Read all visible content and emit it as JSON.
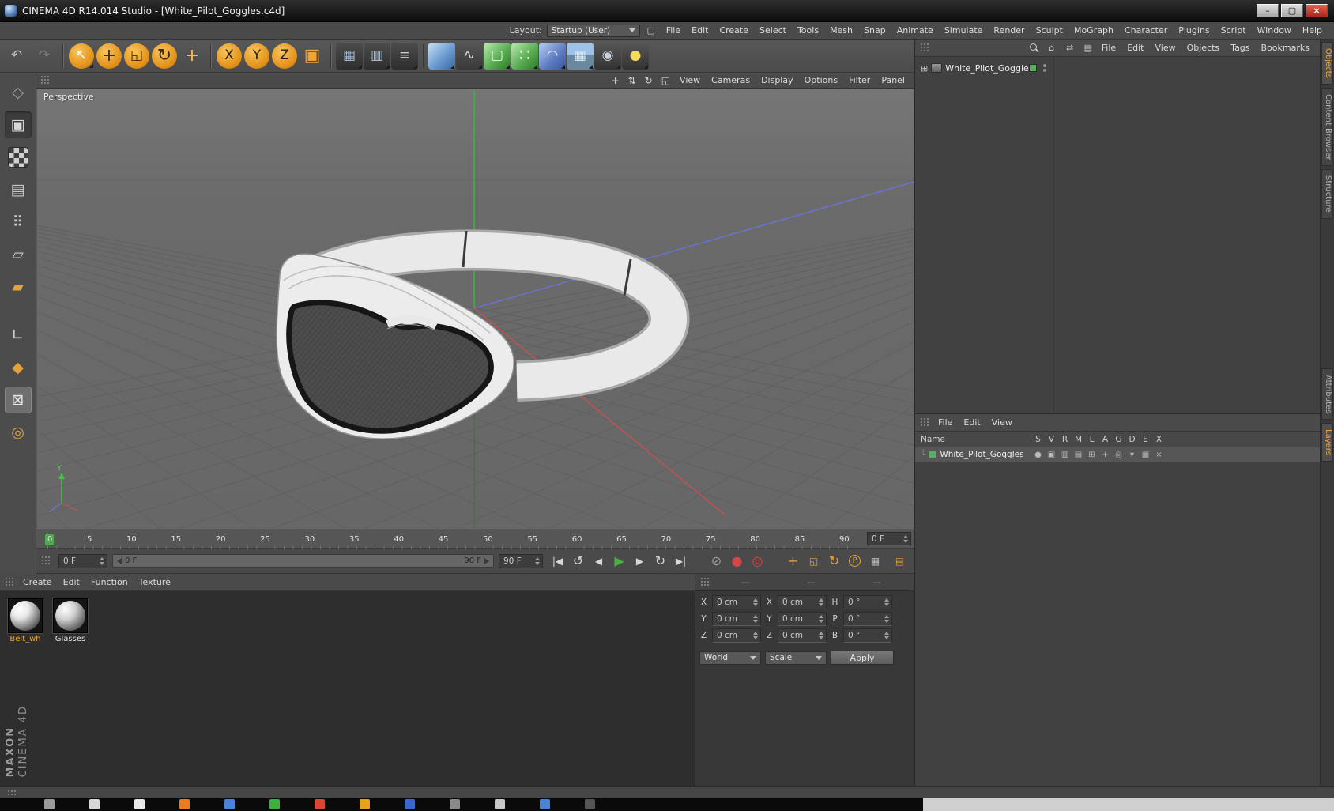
{
  "window": {
    "title": "CINEMA 4D R14.014 Studio - [White_Pilot_Goggles.c4d]",
    "minimize": "–",
    "maximize": "▢",
    "close": "×"
  },
  "menubar": {
    "items": [
      "File",
      "Edit",
      "Create",
      "Select",
      "Tools",
      "Mesh",
      "Snap",
      "Animate",
      "Simulate",
      "Render",
      "Sculpt",
      "MoGraph",
      "Character",
      "Plugins",
      "Script",
      "Window",
      "Help"
    ],
    "layout_label": "Layout:",
    "layout_value": "Startup (User)",
    "pin_glyph": "▢"
  },
  "toolbar": {
    "history": [
      {
        "name": "undo-icon",
        "glyph": "↶",
        "fg": "#c9c9c9"
      },
      {
        "name": "redo-icon",
        "glyph": "↷",
        "fg": "#828282"
      }
    ],
    "tools": [
      {
        "name": "live-selection-icon",
        "glyph": "↖",
        "fg": "#ffffff",
        "bg": "radial-gradient(circle at 38% 32%, #f8c55e, #e28f16 68%, #b06a08)",
        "cls": "round dd"
      },
      {
        "name": "move-tool-icon",
        "glyph": "+",
        "fg": "#3a2a08",
        "bg": "radial-gradient(circle at 38% 32%, #f8c55e, #e28f16 68%, #b06a08)",
        "cls": "round big"
      },
      {
        "name": "scale-tool-icon",
        "glyph": "◱",
        "fg": "#3a2a08",
        "bg": "radial-gradient(circle at 38% 32%, #f8c55e, #e28f16 68%, #b06a08)",
        "cls": "round"
      },
      {
        "name": "rotate-tool-icon",
        "glyph": "↻",
        "fg": "#3a2a08",
        "bg": "radial-gradient(circle at 38% 32%, #f8c55e, #e28f16 68%, #b06a08)",
        "cls": "round big"
      },
      {
        "name": "last-tool-icon",
        "glyph": "+",
        "fg": "#f6c244",
        "cls": "big"
      }
    ],
    "axis": [
      {
        "name": "lock-x-axis-icon",
        "glyph": "X",
        "fg": "#2b2108",
        "bg": "radial-gradient(circle at 38% 32%, #f8c55e, #e28f16 68%, #b06a08)",
        "cls": "round"
      },
      {
        "name": "lock-y-axis-icon",
        "glyph": "Y",
        "fg": "#2b2108",
        "bg": "radial-gradient(circle at 38% 32%, #f8c55e, #e28f16 68%, #b06a08)",
        "cls": "round"
      },
      {
        "name": "lock-z-axis-icon",
        "glyph": "Z",
        "fg": "#2b2108",
        "bg": "radial-gradient(circle at 38% 32%, #f8c55e, #e28f16 68%, #b06a08)",
        "cls": "round"
      },
      {
        "name": "coordinate-system-icon",
        "glyph": "▣",
        "fg": "#f0a43a",
        "cls": "big"
      }
    ],
    "render": [
      {
        "name": "render-view-icon",
        "glyph": "▦",
        "fg": "#a9c1d9",
        "bg": "linear-gradient(#4c4c4c,#2e2e2e)",
        "cls": "dd"
      },
      {
        "name": "render-picture-viewer-icon",
        "glyph": "▥",
        "fg": "#a9c1d9",
        "bg": "linear-gradient(#4c4c4c,#2e2e2e)",
        "cls": "dd"
      },
      {
        "name": "render-settings-icon",
        "glyph": "≡",
        "fg": "#c9c9c9",
        "bg": "linear-gradient(#4c4c4c,#2e2e2e)",
        "cls": "dd"
      }
    ],
    "objects": [
      {
        "name": "add-cube-icon",
        "glyph": "",
        "fg": "#ffffff",
        "bg": "linear-gradient(135deg,#b9d5f1 10%,#6a9ad0 55%,#38659f)",
        "cls": "dd"
      },
      {
        "name": "add-spline-icon",
        "glyph": "∿",
        "fg": "#e2e9f1",
        "bg": "linear-gradient(#565656,#393939)",
        "cls": "dd"
      },
      {
        "name": "add-generator-icon",
        "glyph": "▢",
        "fg": "#eaffea",
        "bg": "linear-gradient(135deg,#a9e1a1 10%,#54a74c 60%,#2e7929)",
        "cls": "dd"
      },
      {
        "name": "add-mograph-icon",
        "glyph": "∷",
        "fg": "#eaffea",
        "bg": "linear-gradient(135deg,#a9e1a1 10%,#54a74c 60%,#2e7929)",
        "cls": "dd big"
      },
      {
        "name": "add-deformer-icon",
        "glyph": "◠",
        "fg": "#e9eef8",
        "bg": "linear-gradient(135deg,#a9c1e9 10%,#5a7ac0 60%,#39549f)",
        "cls": "dd"
      },
      {
        "name": "add-environment-icon",
        "glyph": "▦",
        "fg": "#dce8f4",
        "bg": "linear-gradient(#9fc3e8 45%,#69899f 45%)",
        "cls": "dd"
      },
      {
        "name": "add-camera-icon",
        "glyph": "◉",
        "fg": "#c9d1d9",
        "bg": "linear-gradient(#565656,#333333)",
        "cls": "dd"
      },
      {
        "name": "add-light-icon",
        "glyph": "●",
        "fg": "#f5d860",
        "bg": "linear-gradient(#565656,#333333)",
        "cls": "dd"
      }
    ]
  },
  "palette": [
    {
      "name": "make-editable-icon",
      "glyph": "◇",
      "fg": "#9f9f9f"
    },
    {
      "name": "model-mode-icon",
      "glyph": "▣",
      "fg": "#d8d8d8",
      "cls": "pressed"
    },
    {
      "name": "texture-mode-icon",
      "glyph": "",
      "cls": "checker"
    },
    {
      "name": "workplane-mode-icon",
      "glyph": "▤",
      "fg": "#c8c8c8"
    },
    {
      "name": "points-mode-icon",
      "glyph": "⠿",
      "fg": "#c8c8c8"
    },
    {
      "name": "edges-mode-icon",
      "glyph": "▱",
      "fg": "#c8c8c8"
    },
    {
      "name": "polygons-mode-icon",
      "glyph": "▰",
      "fg": "#e2a23c"
    },
    {
      "name": "coordinate-mode-icon",
      "glyph": "∟",
      "fg": "#d0d0d0",
      "cls": "gap"
    },
    {
      "name": "enable-axis-icon",
      "glyph": "◆",
      "fg": "#e2a23c"
    },
    {
      "name": "lock-workplane-icon",
      "glyph": "⊠",
      "fg": "#e8e8e8",
      "cls": "active"
    },
    {
      "name": "snap-settings-icon",
      "glyph": "◎",
      "fg": "#e2a23c"
    }
  ],
  "viewport": {
    "menu": [
      "View",
      "Cameras",
      "Display",
      "Options",
      "Filter",
      "Panel"
    ],
    "corner_icons": [
      {
        "name": "vp-pan-icon",
        "glyph": "+"
      },
      {
        "name": "vp-dolly-icon",
        "glyph": "⇅"
      },
      {
        "name": "vp-rotate-icon",
        "glyph": "↻"
      },
      {
        "name": "vp-toggle-icon",
        "glyph": "◱"
      }
    ],
    "label": "Perspective",
    "axis_y_label": "Y"
  },
  "timeline": {
    "ticks": [
      "0",
      "5",
      "10",
      "15",
      "20",
      "25",
      "30",
      "35",
      "40",
      "45",
      "50",
      "55",
      "60",
      "65",
      "70",
      "75",
      "80",
      "85",
      "90"
    ],
    "frame_value": "0 F"
  },
  "transport": {
    "current": "0 F",
    "range_start": "0 F",
    "range_end": "90 F",
    "end": "90 F",
    "buttons": [
      {
        "name": "goto-start-button",
        "glyph": "|◀",
        "fg": "#d8d8d8"
      },
      {
        "name": "play-backward-button",
        "glyph": "↺",
        "fg": "#d8d8d8",
        "cls": "big"
      },
      {
        "name": "previous-frame-button",
        "glyph": "◀",
        "fg": "#d8d8d8"
      },
      {
        "name": "play-button",
        "glyph": "▶",
        "fg": "#46b33c",
        "cls": "big"
      },
      {
        "name": "next-frame-button",
        "glyph": "▶",
        "fg": "#d8d8d8"
      },
      {
        "name": "loop-button",
        "glyph": "↻",
        "fg": "#d8d8d8",
        "cls": "big"
      },
      {
        "name": "goto-end-button",
        "glyph": "▶|",
        "fg": "#d8d8d8"
      }
    ],
    "record_buttons": [
      {
        "name": "keyframe-selection-icon",
        "glyph": "⊘",
        "fg": "#9a9a9a",
        "cls": "big"
      },
      {
        "name": "record-keyframe-button",
        "glyph": "●",
        "fg": "#d84545",
        "cls": "big"
      },
      {
        "name": "autokey-button",
        "glyph": "◎",
        "fg": "#d84545",
        "cls": "big"
      }
    ],
    "track_buttons": [
      {
        "name": "record-position-icon",
        "glyph": "+",
        "fg": "#e2a23c",
        "cls": "big"
      },
      {
        "name": "record-scale-icon",
        "glyph": "◱",
        "fg": "#e2a23c"
      },
      {
        "name": "record-rotation-icon",
        "glyph": "↻",
        "fg": "#e2a23c",
        "cls": "big"
      },
      {
        "name": "record-parameter-icon",
        "glyph": "P",
        "fg": "#e2a23c",
        "cls": "ring"
      },
      {
        "name": "record-pla-icon",
        "glyph": "▦",
        "fg": "#c8c8c8"
      }
    ],
    "right_icon": {
      "glyph": "▤",
      "fg": "#e2a23c"
    }
  },
  "materials": {
    "menu": [
      "Create",
      "Edit",
      "Function",
      "Texture"
    ],
    "items": [
      {
        "name": "Belt_wh",
        "label_color": "#f0a43a",
        "sphere": "radial-gradient(circle at 32% 28%, #ffffff, #e8e8e8 30%, #9a9a9a 55%, #2a2a2a 90%)"
      },
      {
        "name": "Glasses",
        "label_color": "#e2e2e2",
        "sphere": "radial-gradient(circle at 32% 28%, #ffffff, #d0d0d0 35%, #888888 60%, #333333 92%)"
      }
    ],
    "watermark_brand": "MAXON",
    "watermark_product": "CINEMA 4D"
  },
  "coordinates": {
    "headers": [
      "—",
      "—",
      "—"
    ],
    "rows": [
      {
        "l1": "X",
        "v1": "0 cm",
        "l2": "X",
        "v2": "0 cm",
        "l3": "H",
        "v3": "0 °"
      },
      {
        "l1": "Y",
        "v1": "0 cm",
        "l2": "Y",
        "v2": "0 cm",
        "l3": "P",
        "v3": "0 °"
      },
      {
        "l1": "Z",
        "v1": "0 cm",
        "l2": "Z",
        "v2": "0 cm",
        "l3": "B",
        "v3": "0 °"
      }
    ],
    "combo_world": "World",
    "combo_scale": "Scale",
    "apply": "Apply"
  },
  "object_manager": {
    "menu": [
      "File",
      "Edit",
      "View",
      "Objects",
      "Tags",
      "Bookmarks"
    ],
    "icons": [
      {
        "name": "search-icon",
        "glyph": "",
        "cls": "mag"
      },
      {
        "name": "home-icon",
        "glyph": "⌂"
      },
      {
        "name": "sync-icon",
        "glyph": "⇄"
      },
      {
        "name": "panel-menu-icon",
        "glyph": "▤"
      }
    ],
    "expand_glyph": "⊞",
    "object_name": "White_Pilot_Goggles"
  },
  "layer_manager": {
    "menu": [
      "File",
      "Edit",
      "View"
    ],
    "name_column": "Name",
    "columns": [
      "S",
      "V",
      "R",
      "M",
      "L",
      "A",
      "G",
      "D",
      "E",
      "X"
    ],
    "row_prefix": "└",
    "row_name": "White_Pilot_Goggles",
    "row_icons": [
      {
        "glyph": "●"
      },
      {
        "glyph": "▣"
      },
      {
        "glyph": "▥"
      },
      {
        "glyph": "▤"
      },
      {
        "glyph": "⊞"
      },
      {
        "glyph": "+"
      },
      {
        "glyph": "◎"
      },
      {
        "glyph": "▾"
      },
      {
        "glyph": "▦"
      },
      {
        "glyph": "×"
      }
    ]
  },
  "side_tabs": {
    "top": [
      {
        "label": "Objects",
        "cls": "active"
      },
      {
        "label": "Content Browser"
      },
      {
        "label": "Structure"
      }
    ],
    "bottom": [
      {
        "label": "Attributes"
      },
      {
        "label": "Layers",
        "cls": "active"
      }
    ]
  },
  "taskbar": {
    "icons": [
      {
        "bg": "#9a9a9a"
      },
      {
        "bg": "#d8d8d8"
      },
      {
        "bg": "#e8e8e8"
      },
      {
        "bg": "#e87c1e"
      },
      {
        "bg": "#4a84d8"
      },
      {
        "bg": "#3fae3f"
      },
      {
        "bg": "#d84830"
      },
      {
        "bg": "#e8a020"
      },
      {
        "bg": "#3a68c8"
      },
      {
        "bg": "#8a8a8a"
      },
      {
        "bg": "#c8c8c8"
      },
      {
        "bg": "#4a84d8"
      },
      {
        "bg": "#555555"
      }
    ]
  }
}
